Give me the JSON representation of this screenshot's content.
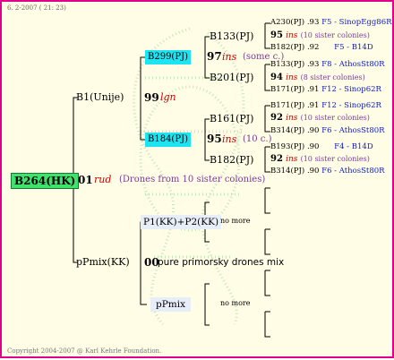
{
  "header": {
    "date": "6. 2-2007 ( 21: 23)"
  },
  "footer": {
    "copyright": "Copyright 2004-2007 @ Karl Kehrle Foundation."
  },
  "root": {
    "label": "B264(HK)",
    "year": "01",
    "race": "rud",
    "note": "(Drones from 10 sister colonies)"
  },
  "mother": {
    "label": "B1(Unije)",
    "year": "99",
    "race": "lgn"
  },
  "mother_mother": {
    "label": "B299(PJ)",
    "year": "97",
    "race": "ins",
    "note": "(some c.)"
  },
  "mother_father": {
    "label": "B184(PJ)",
    "year": "95",
    "race": "ins",
    "note": "(10 c.)"
  },
  "mmm": {
    "label": "B133(PJ)",
    "year": "95",
    "race": "ins",
    "note": "(10 sister colonies)"
  },
  "mmf": {
    "label": "B201(PJ)",
    "year": "94",
    "race": "ins",
    "note": "(8 sister colonies)"
  },
  "mfm": {
    "label": "B161(PJ)",
    "year": "92",
    "race": "ins",
    "note": "(10 sister colonies)"
  },
  "mff": {
    "label": "B182(PJ)",
    "year": "92",
    "race": "ins",
    "note": "(10 sister colonies)"
  },
  "ancestors": [
    {
      "name": "A230(PJ)",
      "year": ".93",
      "info": "F5 - SinopEgg86R"
    },
    {
      "name": "B182(PJ)",
      "year": ".92",
      "info": "F5 - B14D"
    },
    {
      "name": "B133(PJ)",
      "year": ".93",
      "info": "F8 - AthosSt80R"
    },
    {
      "name": "B171(PJ)",
      "year": ".91",
      "info": "F12 - Sinop62R"
    },
    {
      "name": "B171(PJ)",
      "year": ".91",
      "info": "F12 - Sinop62R"
    },
    {
      "name": "B314(PJ)",
      "year": ".90",
      "info": "F6 - AthosSt80R"
    },
    {
      "name": "B193(PJ)",
      "year": ".90",
      "info": "F4 - B14D"
    },
    {
      "name": "B314(PJ)",
      "year": ".90",
      "info": "F6 - AthosSt80R"
    }
  ],
  "father": {
    "label": "pPmix(KK)",
    "year": "00",
    "desc": "pure primorsky drones mix"
  },
  "father_mother": {
    "label": "P1(KK)+P2(KK)",
    "note": "no more"
  },
  "father_father": {
    "label": "pPmix",
    "note": "no more"
  }
}
